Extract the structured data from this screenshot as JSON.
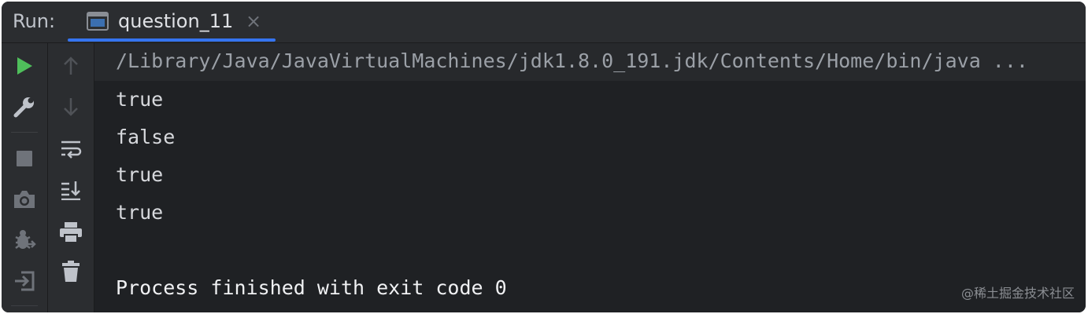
{
  "header": {
    "run_label": "Run:",
    "tab": {
      "title": "question_11",
      "close": "×",
      "icon": "console-window-icon"
    }
  },
  "toolbar_left": [
    {
      "name": "run-icon",
      "color": "#4fbf5b"
    },
    {
      "name": "wrench-icon"
    },
    {
      "name": "stop-icon"
    },
    {
      "name": "camera-icon"
    },
    {
      "name": "debug-bug-icon"
    },
    {
      "name": "exit-icon"
    }
  ],
  "toolbar_right": [
    {
      "name": "arrow-up-icon"
    },
    {
      "name": "arrow-down-icon"
    },
    {
      "name": "soft-wrap-icon"
    },
    {
      "name": "scroll-to-end-icon"
    },
    {
      "name": "print-icon"
    },
    {
      "name": "trash-icon"
    }
  ],
  "console": {
    "command": "/Library/Java/JavaVirtualMachines/jdk1.8.0_191.jdk/Contents/Home/bin/java ...",
    "output": [
      "true",
      "false",
      "true",
      "true"
    ],
    "exit_message": "Process finished with exit code 0"
  },
  "watermark": "@稀土掘金技术社区",
  "colors": {
    "accent": "#3574f0",
    "run_green": "#4fbf5b",
    "background": "#1f2124",
    "panel": "#2b2d30"
  }
}
